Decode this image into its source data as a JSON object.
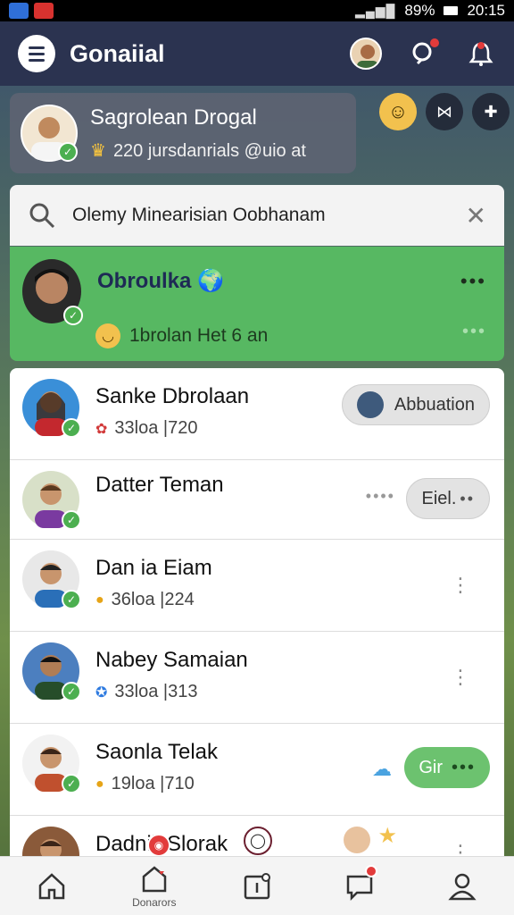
{
  "status_bar": {
    "battery": "89%",
    "time": "20:15"
  },
  "header": {
    "title": "Gonaiial"
  },
  "profile": {
    "name": "Sagrolean Drogal",
    "subtitle": "220 jursdanrials @uio at"
  },
  "search": {
    "value": "Olemy Minearisian Oobhanam"
  },
  "highlight": {
    "name": "Obroulka",
    "subtitle": "1brolan Het 6 an"
  },
  "friends": [
    {
      "name": "Sanke Dbrolaan",
      "meta": "33loa |720",
      "action": "Abbuation",
      "icon": "heart-icon"
    },
    {
      "name": "Datter Teman",
      "meta": "",
      "action": "Eiel.",
      "icon": ""
    },
    {
      "name": "Dan ia Eiam",
      "meta": "36loa |224",
      "action": "",
      "icon": "emoji-icon"
    },
    {
      "name": "Nabey Samaian",
      "meta": "33loa |313",
      "action": "",
      "icon": "verified-icon"
    },
    {
      "name": "Saonla Telak",
      "meta": "19loa |710",
      "action": "Gir",
      "icon": "emoji-icon"
    },
    {
      "name": "Dadnili Slorak",
      "meta": "",
      "action": "",
      "icon": ""
    }
  ],
  "bottom_nav": {
    "label_2": "Donarors"
  },
  "colors": {
    "header": "#2b3350",
    "highlight": "#57b862",
    "accent_red": "#e23b3b"
  }
}
